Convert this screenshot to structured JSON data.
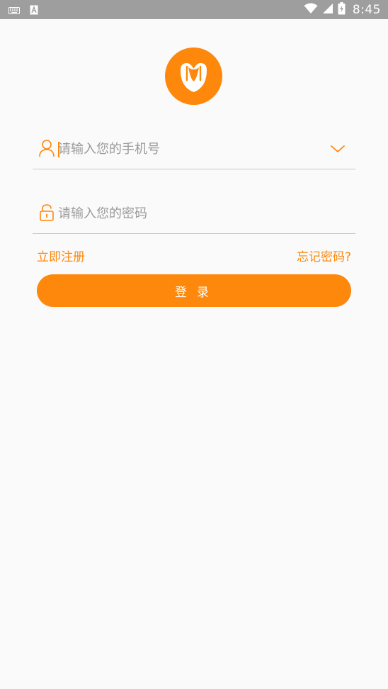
{
  "statusbar": {
    "time": "8:45",
    "left_icons": [
      "keyboard-icon",
      "a-icon"
    ],
    "right_icons": [
      "wifi-icon",
      "signal-icon",
      "battery-charging-icon"
    ]
  },
  "logo": {
    "icon": "app-logo-icon",
    "color": "#fe880c"
  },
  "form": {
    "phone": {
      "placeholder": "请输入您的手机号",
      "value": "",
      "icon": "user-icon",
      "dropdown_icon": "chevron-down-icon"
    },
    "password": {
      "placeholder": "请输入您的密码",
      "value": "",
      "icon": "lock-icon"
    },
    "register_label": "立即注册",
    "forgot_label": "忘记密码?",
    "login_label": "登录"
  },
  "colors": {
    "accent": "#fe880c",
    "statusbar": "#9e9e9e",
    "background": "#fafafa",
    "divider": "#c8c8c8",
    "placeholder": "#9a9a9a"
  }
}
